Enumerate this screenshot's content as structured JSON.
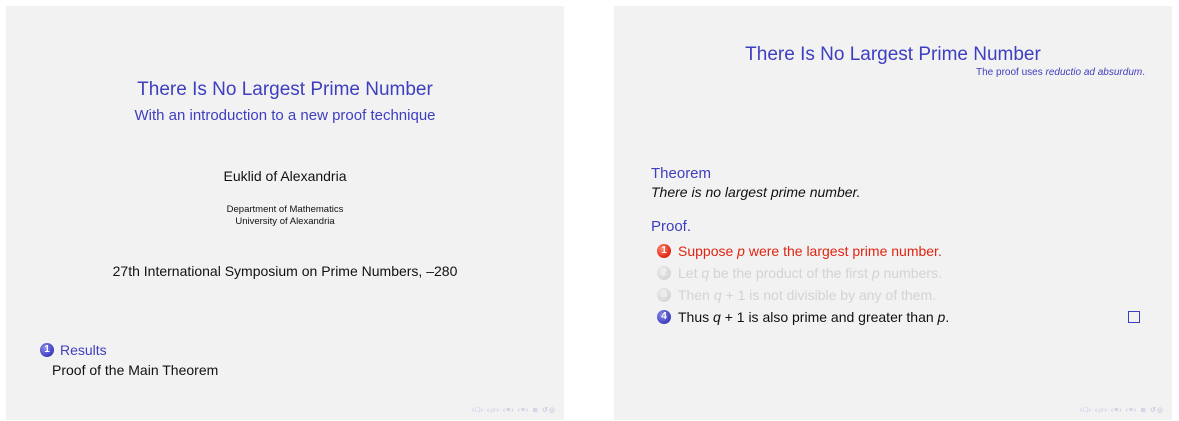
{
  "slide1": {
    "title": "There Is No Largest Prime Number",
    "subtitle": "With an introduction to a new proof technique",
    "author": "Euklid of Alexandria",
    "institute_line1": "Department of Mathematics",
    "institute_line2": "University of Alexandria",
    "date": "27th International Symposium on Prime Numbers, –280",
    "toc": {
      "section_number": "1",
      "section": "Results",
      "subsection": "Proof of the Main Theorem"
    },
    "nav_symbols": "‹□› ‹▱› ‹≡› ‹≡› ≣ ↺◎"
  },
  "slide2": {
    "title": "There Is No Largest Prime Number",
    "subtitle_prefix": "The proof uses ",
    "subtitle_italic": "reductio ad absurdum",
    "subtitle_suffix": ".",
    "theorem_head": "Theorem",
    "theorem_body": "There is no largest prime number.",
    "proof_head": "Proof.",
    "steps": [
      {
        "num": "1",
        "pre": "Suppose ",
        "var": "p",
        "post": " were the largest prime number.",
        "state": "highlight"
      },
      {
        "num": "2",
        "pre": "Let ",
        "var": "q",
        "post": " be the product of the first ",
        "var2": "p",
        "post2": " numbers.",
        "state": "faded"
      },
      {
        "num": "3",
        "pre": "Then ",
        "var": "q",
        "post": " + 1 is not divisible by any of them.",
        "state": "faded"
      },
      {
        "num": "4",
        "pre": "Thus ",
        "var": "q",
        "post": " + 1 is also prime and greater than ",
        "var2": "p",
        "post2": ".",
        "state": "normal"
      }
    ],
    "nav_symbols": "‹□› ‹▱› ‹≡› ‹≡› ≣ ↺◎"
  },
  "colors": {
    "structure": "#3e3ec0",
    "alert": "#e02410",
    "faded": "#d3d3d3",
    "background": "#f2f2f2"
  }
}
